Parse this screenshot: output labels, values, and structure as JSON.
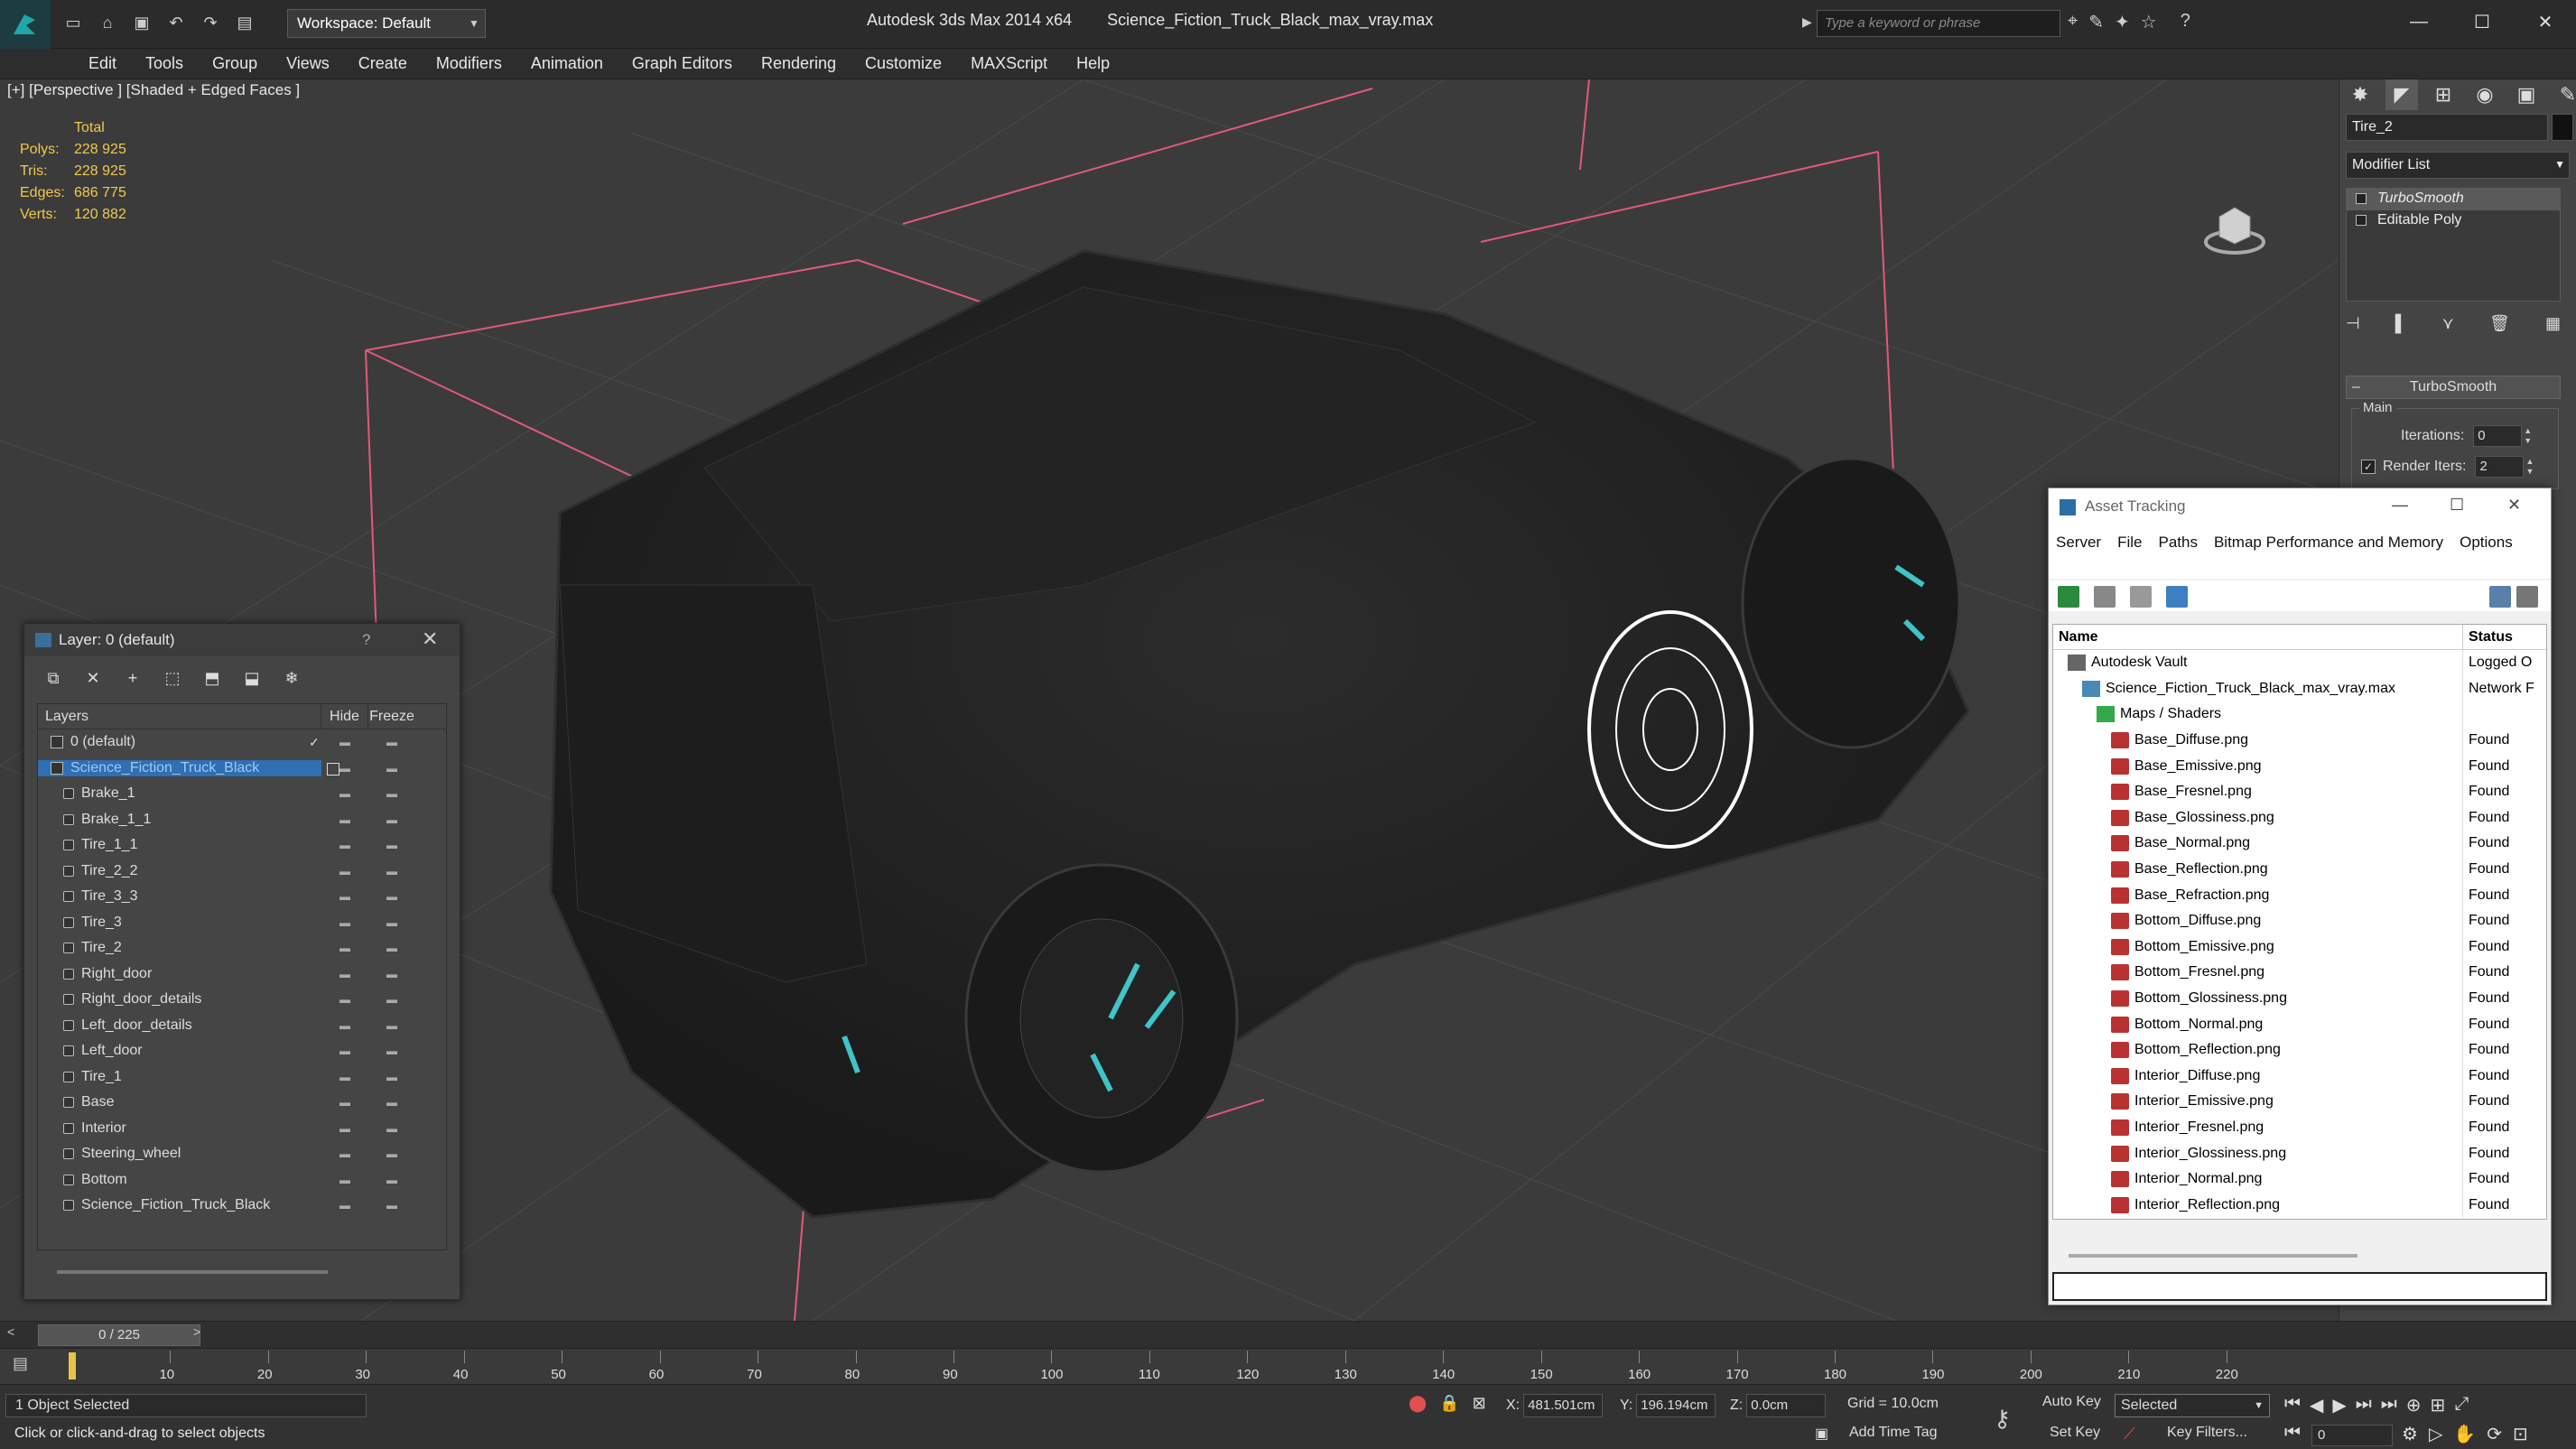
{
  "app": {
    "title": "Autodesk 3ds Max  2014 x64",
    "file": "Science_Fiction_Truck_Black_max_vray.max",
    "workspace": "Workspace: Default",
    "search_placeholder": "Type a keyword or phrase"
  },
  "menu": [
    "Edit",
    "Tools",
    "Group",
    "Views",
    "Create",
    "Modifiers",
    "Animation",
    "Graph Editors",
    "Rendering",
    "Customize",
    "MAXScript",
    "Help"
  ],
  "viewport": {
    "label": "[+] [Perspective ] [Shaded + Edged Faces ]",
    "stats": {
      "header": "Total",
      "rows": [
        {
          "k": "Polys:",
          "v": "228 925"
        },
        {
          "k": "Tris:",
          "v": "228 925"
        },
        {
          "k": "Edges:",
          "v": "686 775"
        },
        {
          "k": "Verts:",
          "v": "120 882"
        }
      ]
    }
  },
  "command_panel": {
    "object_name": "Tire_2",
    "modifier_list": "Modifier List",
    "stack": [
      "TurboSmooth",
      "Editable Poly"
    ],
    "rollout": "TurboSmooth",
    "group": "Main",
    "iterations_label": "Iterations:",
    "iterations": "0",
    "render_iters_label": "Render Iters:",
    "render_iters": "2"
  },
  "layer_panel": {
    "title": "Layer: 0 (default)",
    "help": "?",
    "columns": [
      "Layers",
      "Hide",
      "Freeze"
    ],
    "rows": [
      {
        "name": "0 (default)",
        "level": 0,
        "type": "layer",
        "selected": false
      },
      {
        "name": "Science_Fiction_Truck_Black",
        "level": 0,
        "type": "layer",
        "selected": true
      },
      {
        "name": "Brake_1",
        "level": 1,
        "type": "object",
        "selected": false
      },
      {
        "name": "Brake_1_1",
        "level": 1,
        "type": "object",
        "selected": false
      },
      {
        "name": "Tire_1_1",
        "level": 1,
        "type": "object",
        "selected": false
      },
      {
        "name": "Tire_2_2",
        "level": 1,
        "type": "object",
        "selected": false
      },
      {
        "name": "Tire_3_3",
        "level": 1,
        "type": "object",
        "selected": false
      },
      {
        "name": "Tire_3",
        "level": 1,
        "type": "object",
        "selected": false
      },
      {
        "name": "Tire_2",
        "level": 1,
        "type": "object",
        "selected": false
      },
      {
        "name": "Right_door",
        "level": 1,
        "type": "object",
        "selected": false
      },
      {
        "name": "Right_door_details",
        "level": 1,
        "type": "object",
        "selected": false
      },
      {
        "name": "Left_door_details",
        "level": 1,
        "type": "object",
        "selected": false
      },
      {
        "name": "Left_door",
        "level": 1,
        "type": "object",
        "selected": false
      },
      {
        "name": "Tire_1",
        "level": 1,
        "type": "object",
        "selected": false
      },
      {
        "name": "Base",
        "level": 1,
        "type": "object",
        "selected": false
      },
      {
        "name": "Interior",
        "level": 1,
        "type": "object",
        "selected": false
      },
      {
        "name": "Steering_wheel",
        "level": 1,
        "type": "object",
        "selected": false
      },
      {
        "name": "Bottom",
        "level": 1,
        "type": "object",
        "selected": false
      },
      {
        "name": "Science_Fiction_Truck_Black",
        "level": 1,
        "type": "object",
        "selected": false
      }
    ]
  },
  "asset_tracking": {
    "title": "Asset Tracking",
    "menu": [
      "Server",
      "File",
      "Paths",
      "Bitmap Performance and Memory",
      "Options"
    ],
    "columns": [
      "Name",
      "Status"
    ],
    "rows": [
      {
        "name": "Autodesk Vault",
        "status": "Logged O",
        "level": 1,
        "icon": "vault"
      },
      {
        "name": "Science_Fiction_Truck_Black_max_vray.max",
        "status": "Network F",
        "level": 2,
        "icon": "max"
      },
      {
        "name": "Maps / Shaders",
        "status": "",
        "level": 3,
        "icon": "maps"
      },
      {
        "name": "Base_Diffuse.png",
        "status": "Found",
        "level": 4,
        "icon": "png"
      },
      {
        "name": "Base_Emissive.png",
        "status": "Found",
        "level": 4,
        "icon": "png"
      },
      {
        "name": "Base_Fresnel.png",
        "status": "Found",
        "level": 4,
        "icon": "png"
      },
      {
        "name": "Base_Glossiness.png",
        "status": "Found",
        "level": 4,
        "icon": "png"
      },
      {
        "name": "Base_Normal.png",
        "status": "Found",
        "level": 4,
        "icon": "png"
      },
      {
        "name": "Base_Reflection.png",
        "status": "Found",
        "level": 4,
        "icon": "png"
      },
      {
        "name": "Base_Refraction.png",
        "status": "Found",
        "level": 4,
        "icon": "png"
      },
      {
        "name": "Bottom_Diffuse.png",
        "status": "Found",
        "level": 4,
        "icon": "png"
      },
      {
        "name": "Bottom_Emissive.png",
        "status": "Found",
        "level": 4,
        "icon": "png"
      },
      {
        "name": "Bottom_Fresnel.png",
        "status": "Found",
        "level": 4,
        "icon": "png"
      },
      {
        "name": "Bottom_Glossiness.png",
        "status": "Found",
        "level": 4,
        "icon": "png"
      },
      {
        "name": "Bottom_Normal.png",
        "status": "Found",
        "level": 4,
        "icon": "png"
      },
      {
        "name": "Bottom_Reflection.png",
        "status": "Found",
        "level": 4,
        "icon": "png"
      },
      {
        "name": "Interior_Diffuse.png",
        "status": "Found",
        "level": 4,
        "icon": "png"
      },
      {
        "name": "Interior_Emissive.png",
        "status": "Found",
        "level": 4,
        "icon": "png"
      },
      {
        "name": "Interior_Fresnel.png",
        "status": "Found",
        "level": 4,
        "icon": "png"
      },
      {
        "name": "Interior_Glossiness.png",
        "status": "Found",
        "level": 4,
        "icon": "png"
      },
      {
        "name": "Interior_Normal.png",
        "status": "Found",
        "level": 4,
        "icon": "png"
      },
      {
        "name": "Interior_Reflection.png",
        "status": "Found",
        "level": 4,
        "icon": "png"
      }
    ]
  },
  "timeline": {
    "frame_display": "0 / 225",
    "ticks": [
      "10",
      "20",
      "30",
      "40",
      "50",
      "60",
      "70",
      "80",
      "90",
      "100",
      "110",
      "120",
      "130",
      "140",
      "150",
      "160",
      "170",
      "180",
      "190",
      "200",
      "210",
      "220"
    ]
  },
  "status": {
    "selection": "1 Object Selected",
    "prompt": "Click or click-and-drag to select objects",
    "x_label": "X:",
    "x": "481.501cm",
    "y_label": "Y:",
    "y": "196.194cm",
    "z_label": "Z:",
    "z": "0.0cm",
    "grid": "Grid = 10.0cm",
    "auto_key": "Auto Key",
    "set_key": "Set Key",
    "selected_mode": "Selected",
    "key_filters": "Key Filters...",
    "add_time_tag": "Add Time Tag",
    "frame": "0"
  },
  "colors": {
    "selection_blue": "#2f6fb3",
    "stats_yellow": "#f2c94c",
    "bbox_pink": "#e05a7a",
    "accent_cyan": "#3fc4c8"
  }
}
